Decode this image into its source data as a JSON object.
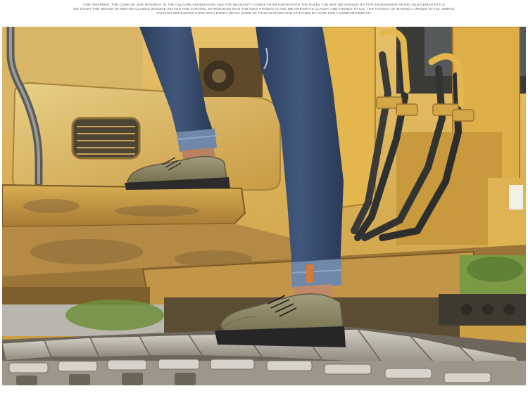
{
  "caption": {
    "lines": [
      "OUR INSPIRING, THE CORE OF OUR INTEREST IN THE CULTURE SHOEMAKING AND THE NECESSITY COMES FROM INSPIRATION THE RULES THE WAY WE SHOULD DO FOR SHOEMAKING RETRO GENTLEMAN STYLE",
      "WE STUDY THE DESIGN OF BRITISH CLASSIC BROGUE DETAILS AND CARVING, INTRODUCED INTO THE REAL PRODUCTS AND WE INTEGRATE CLASSIC AND TRENDY STYLE, THE PURSUIT OF MAKING A UNIQUE STYLE, SIMPLE",
      "FASHION GENTLEMAN SHOE WITH EVERY DETAIL MADE OF TRUE LEATHER AND STITCHED BY HAND FOR A COMFORTABLE FIT"
    ]
  },
  "photo": {
    "subject": "legs-in-jeans-brogue-shoes-on-excavator",
    "colors": {
      "excavator_yellow": "#d9ad45",
      "mud": "#8a6a3a",
      "denim": "#34496a",
      "shoe_suede": "#8c8466",
      "sole": "#2b2b2b",
      "track_steel": "#b9b4aa",
      "foliage": "#6f8f3c"
    }
  }
}
